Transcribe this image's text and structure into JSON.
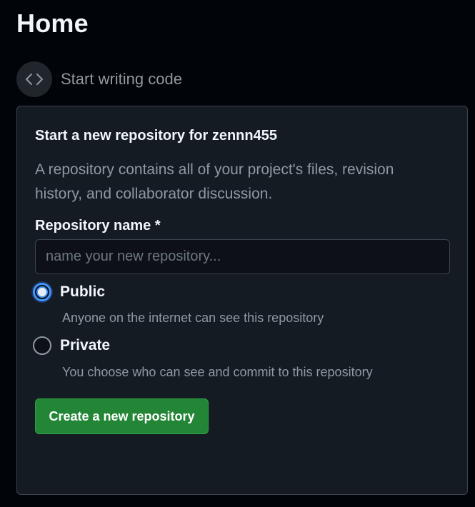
{
  "header": {
    "title": "Home"
  },
  "start_section": {
    "icon": "code-icon",
    "label": "Start writing code"
  },
  "new_repo_card": {
    "heading": "Start a new repository for zennn455",
    "description": "A repository contains all of your project's files, revision history, and collaborator discussion.",
    "name_field": {
      "label": "Repository name *",
      "value": "",
      "placeholder": "name your new repository..."
    },
    "visibility": {
      "selected": "Public",
      "options": [
        {
          "label": "Public",
          "description": "Anyone on the internet can see this repository",
          "checked": true
        },
        {
          "label": "Private",
          "description": "You choose who can see and commit to this repository",
          "checked": false
        }
      ]
    },
    "create_button_label": "Create a new repository"
  },
  "colors": {
    "background": "#010409",
    "card_background": "#151b23",
    "accent_blue": "#4493f8",
    "button_green": "#238636"
  }
}
